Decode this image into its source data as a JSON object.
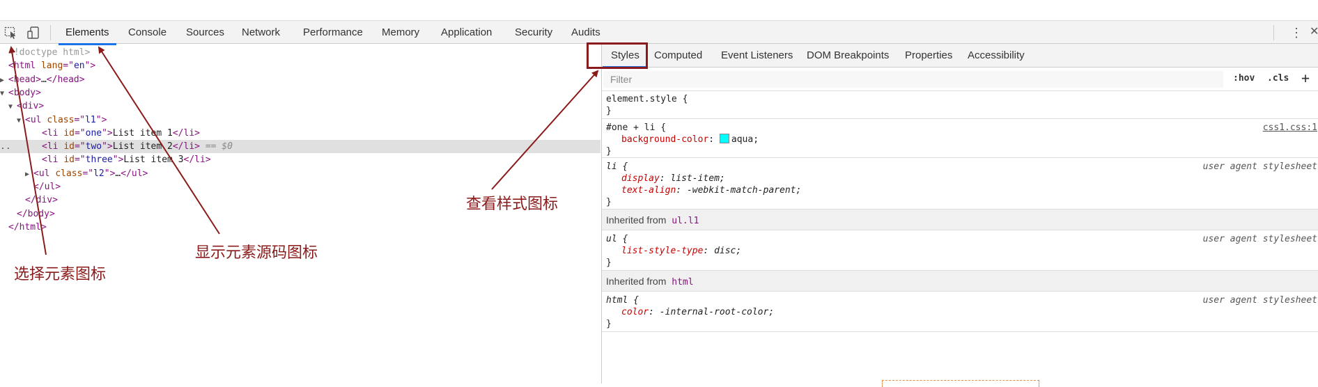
{
  "toolbar": {
    "tabs": [
      {
        "label": "Elements",
        "active": true
      },
      {
        "label": "Console"
      },
      {
        "label": "Sources"
      },
      {
        "label": "Network"
      },
      {
        "label": "Performance"
      },
      {
        "label": "Memory"
      },
      {
        "label": "Application"
      },
      {
        "label": "Security"
      },
      {
        "label": "Audits"
      }
    ]
  },
  "dom": {
    "lines": [
      {
        "indent": 0,
        "parts": [
          [
            "cmt",
            "<!doctype html>"
          ]
        ]
      },
      {
        "indent": 0,
        "parts": [
          [
            "tag",
            "<html "
          ],
          [
            "attr",
            "lang"
          ],
          [
            "tag",
            "=\""
          ],
          [
            "val",
            "en"
          ],
          [
            "tag",
            "\">"
          ]
        ]
      },
      {
        "indent": 0,
        "tri": "▶",
        "parts": [
          [
            "tag",
            "<head>"
          ],
          [
            "txt",
            "…"
          ],
          [
            "tag",
            "</head>"
          ]
        ]
      },
      {
        "indent": 0,
        "tri": "▼",
        "parts": [
          [
            "tag",
            "<body>"
          ]
        ]
      },
      {
        "indent": 1,
        "tri": "▼",
        "parts": [
          [
            "tag",
            "<div>"
          ]
        ]
      },
      {
        "indent": 2,
        "tri": "▼",
        "parts": [
          [
            "tag",
            "<ul "
          ],
          [
            "attr",
            "class"
          ],
          [
            "tag",
            "=\""
          ],
          [
            "val",
            "l1"
          ],
          [
            "tag",
            "\">"
          ]
        ]
      },
      {
        "indent": 4,
        "parts": [
          [
            "tag",
            "<li "
          ],
          [
            "attr",
            "id"
          ],
          [
            "tag",
            "=\""
          ],
          [
            "val",
            "one"
          ],
          [
            "tag",
            "\">"
          ],
          [
            "txt",
            "List item 1"
          ],
          [
            "tag",
            "</li>"
          ]
        ]
      },
      {
        "indent": 4,
        "selected": true,
        "parts": [
          [
            "tag",
            "<li "
          ],
          [
            "attr",
            "id"
          ],
          [
            "tag",
            "=\""
          ],
          [
            "val",
            "two"
          ],
          [
            "tag",
            "\">"
          ],
          [
            "txt",
            "List item 2"
          ],
          [
            "tag",
            "</li>"
          ],
          [
            "eq",
            " == $0"
          ]
        ]
      },
      {
        "indent": 4,
        "parts": [
          [
            "tag",
            "<li "
          ],
          [
            "attr",
            "id"
          ],
          [
            "tag",
            "=\""
          ],
          [
            "val",
            "three"
          ],
          [
            "tag",
            "\">"
          ],
          [
            "txt",
            "List item 3"
          ],
          [
            "tag",
            "</li>"
          ]
        ]
      },
      {
        "indent": 3,
        "tri": "▶",
        "parts": [
          [
            "tag",
            "<ul "
          ],
          [
            "attr",
            "class"
          ],
          [
            "tag",
            "=\""
          ],
          [
            "val",
            "l2"
          ],
          [
            "tag",
            "\">"
          ],
          [
            "txt",
            "…"
          ],
          [
            "tag",
            "</ul>"
          ]
        ]
      },
      {
        "indent": 3,
        "parts": [
          [
            "tag",
            "</ul>"
          ]
        ]
      },
      {
        "indent": 2,
        "parts": [
          [
            "tag",
            "</div>"
          ]
        ]
      },
      {
        "indent": 1,
        "parts": [
          [
            "tag",
            "</body>"
          ]
        ]
      },
      {
        "indent": 0,
        "parts": [
          [
            "tag",
            "</html>"
          ]
        ]
      }
    ],
    "selected_marker": ".."
  },
  "styles": {
    "subtabs": [
      {
        "label": "Styles",
        "active": true
      },
      {
        "label": "Computed"
      },
      {
        "label": "Event Listeners"
      },
      {
        "label": "DOM Breakpoints"
      },
      {
        "label": "Properties"
      },
      {
        "label": "Accessibility"
      }
    ],
    "filter_placeholder": "Filter",
    "hov_label": ":hov",
    "cls_label": ".cls",
    "add_label": "+",
    "element_style": {
      "selector": "element.style {",
      "close": "}"
    },
    "rule_one": {
      "selector": "#one + li {",
      "source": "css1.css:1",
      "prop": "background-color",
      "value": "aqua;",
      "swatch_color": "#00ffff",
      "close": "}"
    },
    "rule_li": {
      "selector": "li {",
      "source": "user agent stylesheet",
      "prop1": "display",
      "value1": "list-item;",
      "prop2": "text-align",
      "value2": "-webkit-match-parent;",
      "close": "}"
    },
    "inherited_ul": {
      "label": "Inherited from",
      "selector": "ul.l1"
    },
    "rule_ul": {
      "selector": "ul {",
      "source": "user agent stylesheet",
      "prop": "list-style-type",
      "value": "disc;",
      "close": "}"
    },
    "inherited_html": {
      "label": "Inherited from",
      "selector": "html"
    },
    "rule_html": {
      "selector": "html {",
      "source": "user agent stylesheet",
      "prop": "color",
      "value": "-internal-root-color;",
      "close": "}"
    }
  },
  "annotations": {
    "select_element": "选择元素图标",
    "show_source": "显示元素源码图标",
    "view_style": "查看样式图标"
  },
  "colors": {
    "annotation": "#8b1a1a",
    "active_tab": "#1a73e8"
  }
}
